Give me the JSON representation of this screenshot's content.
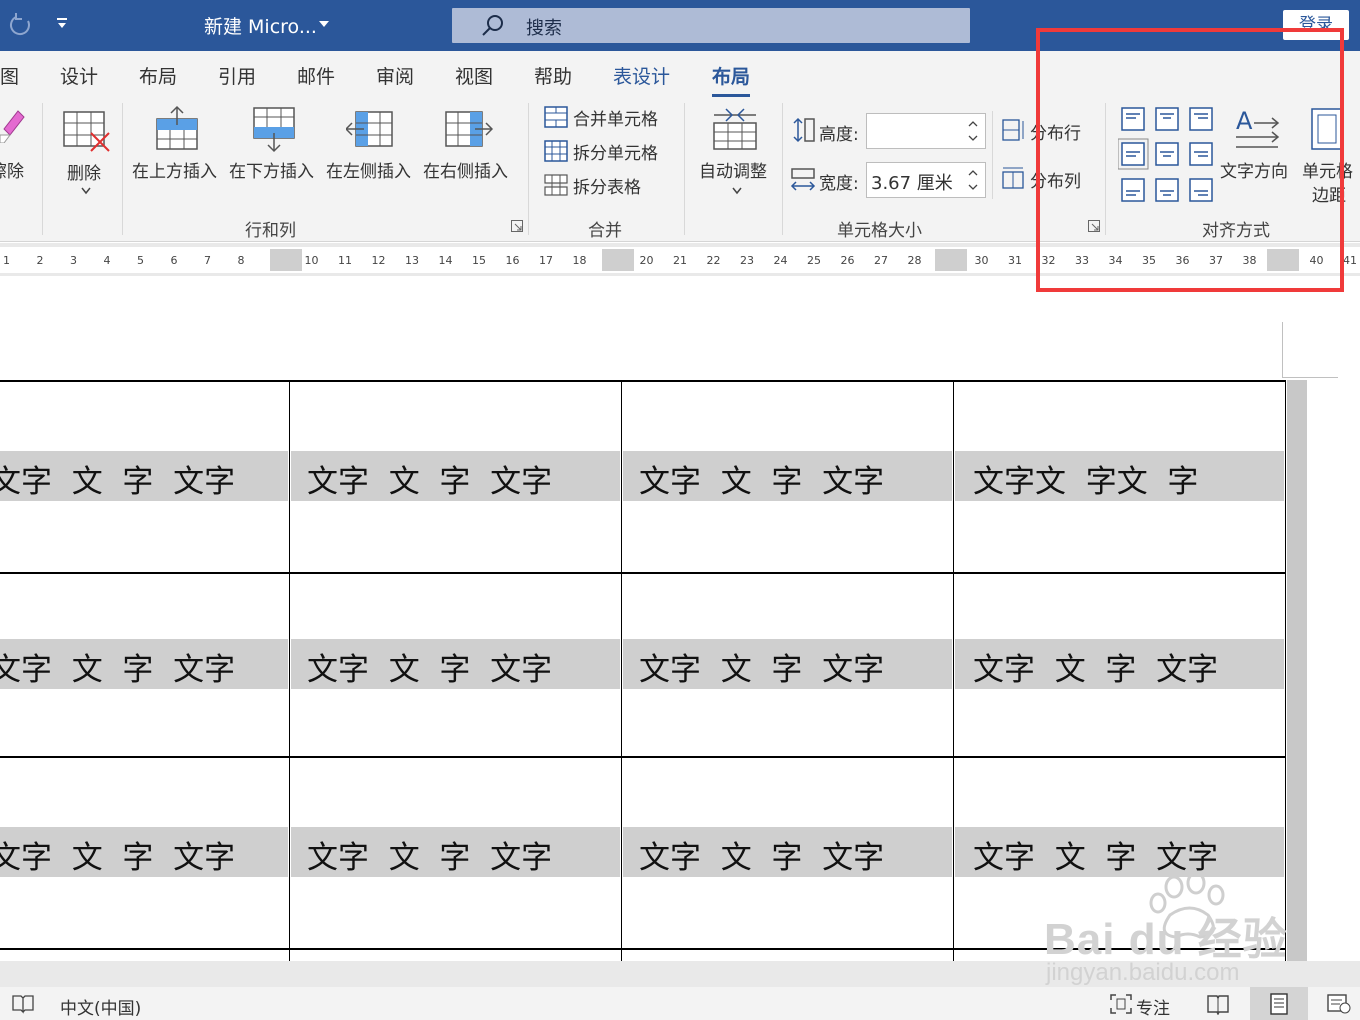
{
  "titlebar": {
    "doc_title": "新建 Micro...",
    "search_placeholder": "搜索",
    "login_label": "登录"
  },
  "tabs": [
    "图",
    "设计",
    "布局",
    "引用",
    "邮件",
    "审阅",
    "视图",
    "帮助",
    "表设计",
    "布局"
  ],
  "active_tab": "布局",
  "ribbon": {
    "eraser_label": "擦除",
    "delete_label": "删除",
    "insert_above": "在上方插入",
    "insert_below": "在下方插入",
    "insert_left": "在左侧插入",
    "insert_right": "在右侧插入",
    "group_rows_cols": "行和列",
    "merge_cells": "合并单元格",
    "split_cells": "拆分单元格",
    "split_table": "拆分表格",
    "group_merge": "合并",
    "autofit": "自动调整",
    "height_label": "高度:",
    "height_value": "",
    "width_label": "宽度:",
    "width_value": "3.67 厘米",
    "distribute_rows": "分布行",
    "distribute_cols": "分布列",
    "group_cell_size": "单元格大小",
    "text_direction": "文字方向",
    "cell_margins_1": "单元格",
    "cell_margins_2": "边距",
    "group_alignment": "对齐方式"
  },
  "ruler_numbers": [
    "1",
    "2",
    "3",
    "4",
    "5",
    "6",
    "7",
    "8",
    "10",
    "11",
    "12",
    "13",
    "14",
    "15",
    "16",
    "17",
    "18",
    "20",
    "21",
    "22",
    "23",
    "24",
    "25",
    "26",
    "27",
    "28",
    "30",
    "31",
    "32",
    "33",
    "34",
    "35",
    "36",
    "37",
    "38",
    "40",
    "41"
  ],
  "table": {
    "rows": [
      [
        "文字  文  字  文字",
        "文字  文  字  文字",
        "文字  文  字  文字",
        "文字文  字文  字"
      ],
      [
        "文字  文  字  文字",
        "文字  文  字  文字",
        "文字  文  字  文字",
        "文字  文  字  文字"
      ],
      [
        "文字  文  字  文字",
        "文字  文  字  文字",
        "文字  文  字  文字",
        "文字  文  字  文字"
      ]
    ]
  },
  "status": {
    "language": "中文(中国)",
    "focus": "专注"
  },
  "watermark": {
    "brand": "Bai du 经验",
    "url": "jingyan.baidu.com"
  },
  "colors": {
    "titlebar": "#2b579a",
    "highlight_box": "#f03a3a",
    "accent": "#2b579a"
  }
}
